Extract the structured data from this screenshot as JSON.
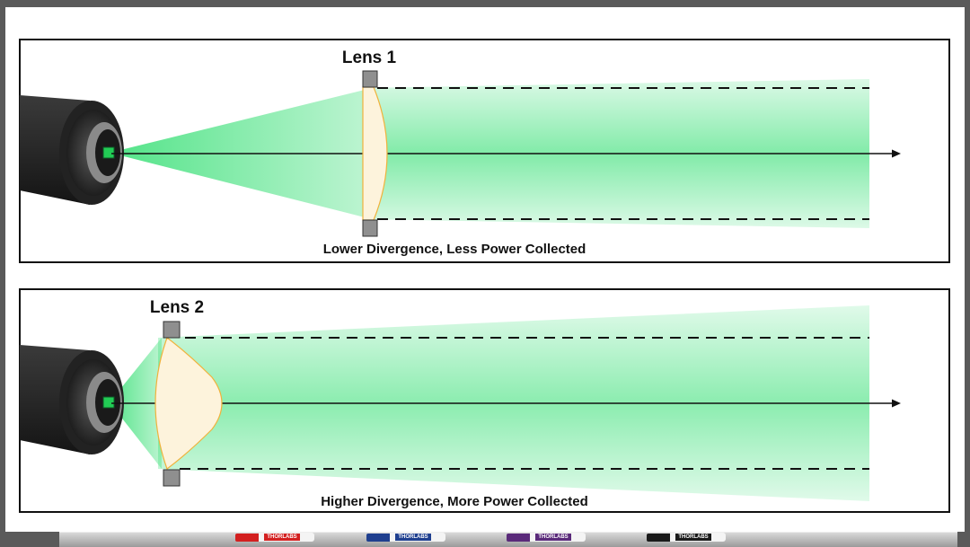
{
  "panels": [
    {
      "lens_label": "Lens 1",
      "caption": "Lower Divergence, Less Power Collected"
    },
    {
      "lens_label": "Lens 2",
      "caption": "Higher Divergence, More Power Collected"
    }
  ],
  "markers": [
    {
      "brand": "THORLABS",
      "color": "#d32020"
    },
    {
      "brand": "THORLABS",
      "color": "#1f3f8f"
    },
    {
      "brand": "THORLABS",
      "color": "#5a2a7a"
    },
    {
      "brand": "THORLABS",
      "color": "#1a1a1a"
    }
  ],
  "colors": {
    "beam": "#3ee07a",
    "lens": "#fdf3dc",
    "lens_edge": "#f0b23c",
    "emitter": "#22cc55"
  },
  "icons": [
    "laser-diode-icon",
    "lens-mount-icon",
    "arrow-right-icon",
    "marker-icon"
  ]
}
